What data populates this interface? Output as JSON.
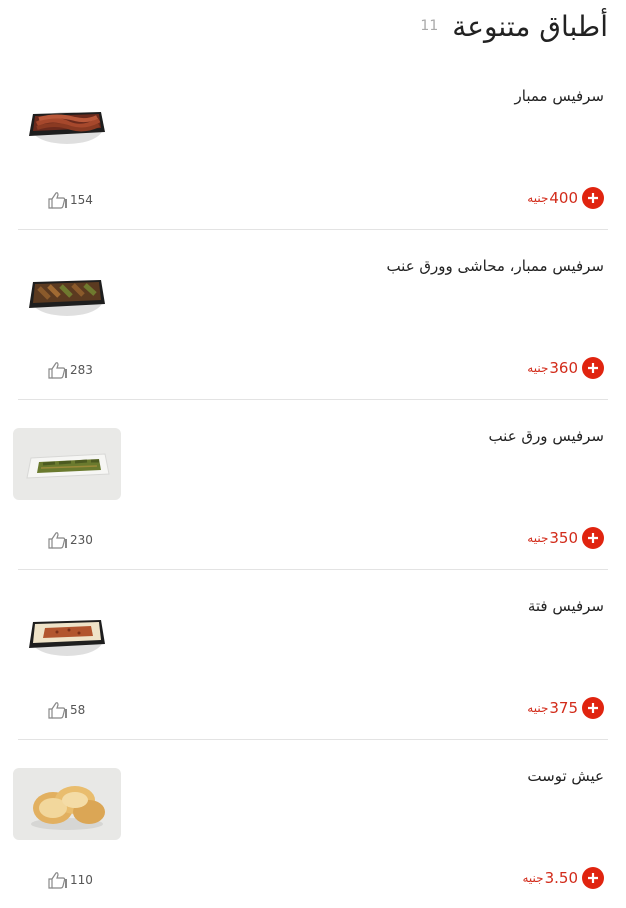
{
  "section": {
    "title": "أطباق متنوعة",
    "count": "11"
  },
  "items": [
    {
      "name": "سرفيس ممبار",
      "price": "400",
      "currency": "جنيه",
      "likes": "154",
      "image": "sausage-tray-image"
    },
    {
      "name": "سرفيس ممبار، محاشى وورق عنب",
      "price": "360",
      "currency": "جنيه",
      "likes": "283",
      "image": "mixed-stuffed-tray-image"
    },
    {
      "name": "سرفيس ورق عنب",
      "price": "350",
      "currency": "جنيه",
      "likes": "230",
      "image": "grape-leaves-plate-image"
    },
    {
      "name": "سرفيس فتة",
      "price": "375",
      "currency": "جنيه",
      "likes": "58",
      "image": "fatta-tray-image"
    },
    {
      "name": "عيش توست",
      "price": "3.50",
      "currency": "جنيه",
      "likes": "110",
      "image": "toast-bread-image"
    }
  ],
  "colors": {
    "accent": "#e0240f",
    "price": "#d22b1a",
    "divider": "#e3e3e3"
  },
  "icons": {
    "add": "plus-icon",
    "like": "thumbs-up-icon"
  }
}
